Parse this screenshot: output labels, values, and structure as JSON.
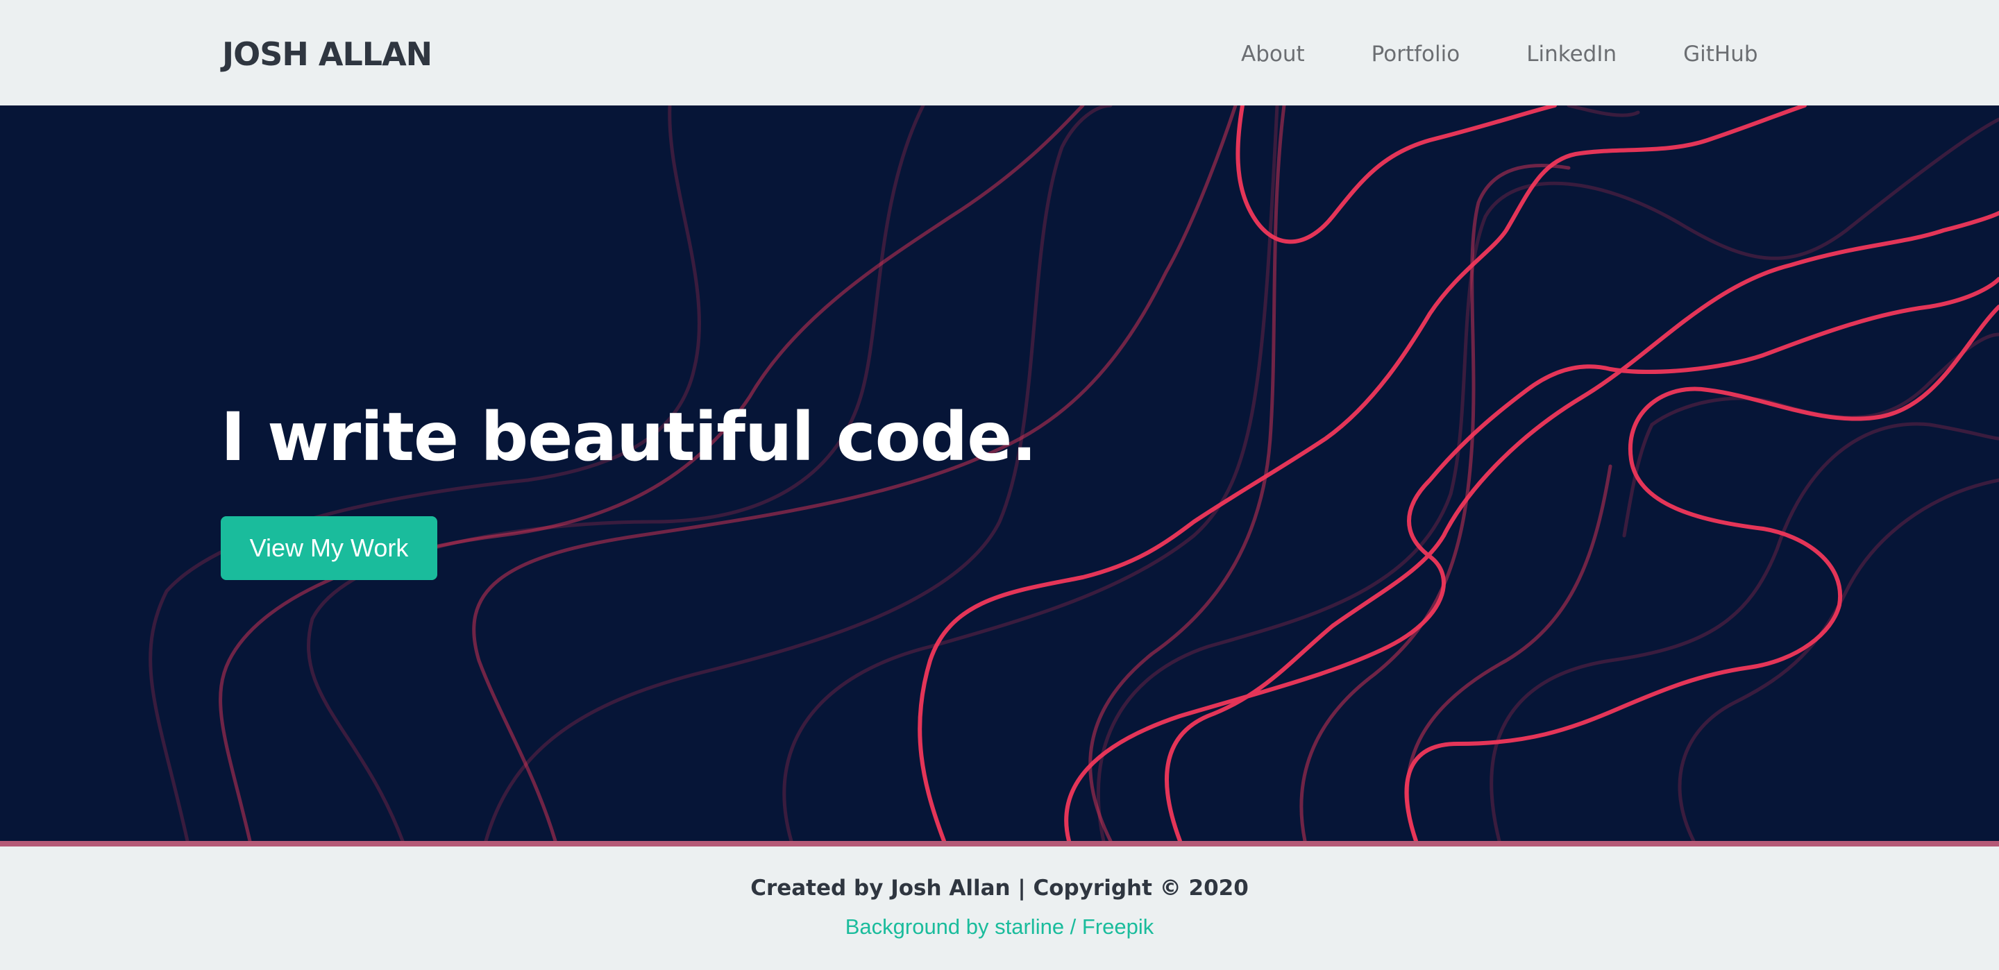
{
  "navbar": {
    "brand": "JOSH ALLAN",
    "links": [
      "About",
      "Portfolio",
      "LinkedIn",
      "GitHub"
    ]
  },
  "hero": {
    "title": "I write beautiful code.",
    "cta_label": "View My Work",
    "background_color": "#061537",
    "line_color": "#f0375a"
  },
  "footer": {
    "credit": "Created by Josh Allan | Copyright © 2020",
    "attribution": "Background by starline / Freepik"
  },
  "colors": {
    "accent": "#1abc9c",
    "nav_background": "#ecf0f1",
    "divider": "#b55a77"
  }
}
